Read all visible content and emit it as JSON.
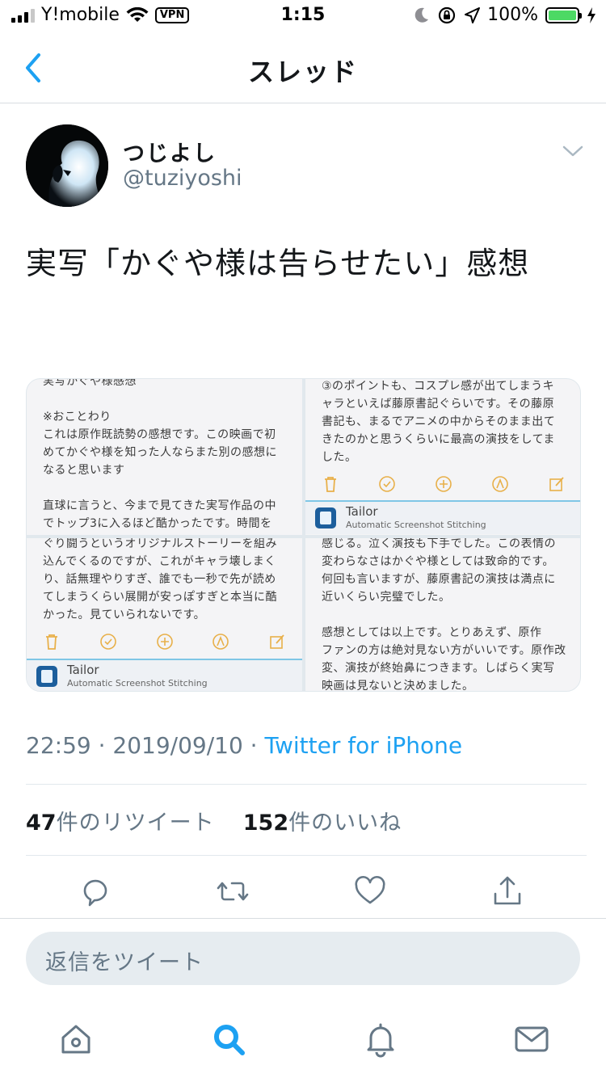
{
  "status_bar": {
    "carrier": "Y!mobile",
    "vpn": "VPN",
    "time": "1:15",
    "battery": "100%"
  },
  "nav": {
    "title": "スレッド"
  },
  "tweet": {
    "display_name": "つじよし",
    "handle": "@tuziyoshi",
    "text": "実写「かぐや様は告らせたい」感想",
    "timestamp": "22:59 · 2019/09/10 · ",
    "source": "Twitter for iPhone",
    "retweet_count": "47",
    "retweet_label": "件のリツイート",
    "like_count": "152",
    "like_label": "件のいいね"
  },
  "media": {
    "app_name": "Tailor",
    "app_subtitle": "Automatic Screenshot Stitching",
    "tile1_text": "実写かぐや様感想\n\n※おことわり\nこれは原作既読勢の感想です。この映画で初\nめてかぐや様を知った人ならまた別の感想に\nなると思います\n\n直球に言うと、今まで見てきた実写作品の中\nでトップ3に入るほど酷かったです。時間を",
    "tile2_text": "③のポイントも、コスプレ感が出てしまうキ\nャラといえば藤原書記ぐらいです。その藤原\n書記も、まるでアニメの中からそのまま出て\nきたのかと思うくらいに最高の演技をしてま\nした。",
    "tile3_text": "ぐり闘うというオリジナルストーリーを組み\n込んでくるのですが、これがキャラ壊しまく\nり、話無理やりすぎ、誰でも一秒で先が読め\nてしまうくらい展開が安っぽすぎと本当に酷\nかった。見ていられないです。",
    "tile4_text": "感じる。泣く演技も下手でした。この表情の\n変わらなさはかぐや様としては致命的です。\n何回も言いますが、藤原書記の演技は満点に\n近いくらい完璧でした。\n\n感想としては以上です。とりあえず、原作\nファンの方は絶対見ない方がいいです。原作改\n変、演技が終始鼻につきます。しばらく実写\n映画は見ないと決めました。"
  },
  "reply": {
    "placeholder": "返信をツイート"
  },
  "colors": {
    "accent": "#1da1f2",
    "secondary_text": "#657786",
    "divider": "#e1e8ed"
  },
  "icons": {
    "actions": [
      "reply-icon",
      "retweet-icon",
      "like-icon",
      "share-icon"
    ],
    "tabs": [
      "home-icon",
      "search-icon",
      "notifications-icon",
      "messages-icon"
    ]
  }
}
